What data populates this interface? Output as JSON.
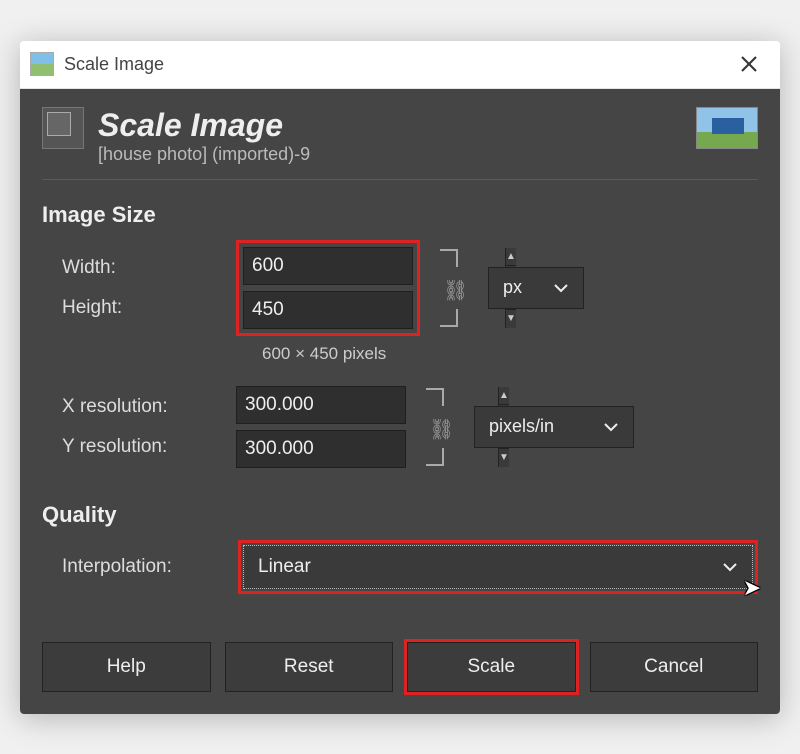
{
  "titlebar": {
    "title": "Scale Image"
  },
  "header": {
    "title": "Scale Image",
    "subtitle": "[house photo] (imported)-9"
  },
  "image_size": {
    "section_title": "Image Size",
    "width_label": "Width:",
    "height_label": "Height:",
    "width_value": "600",
    "height_value": "450",
    "unit_label": "px",
    "pixel_note": "600 × 450 pixels"
  },
  "resolution": {
    "x_label": "X resolution:",
    "y_label": "Y resolution:",
    "x_value": "300.000",
    "y_value": "300.000",
    "unit_label": "pixels/in"
  },
  "quality": {
    "section_title": "Quality",
    "interpolation_label": "Interpolation:",
    "interpolation_value": "Linear"
  },
  "buttons": {
    "help": "Help",
    "reset": "Reset",
    "scale": "Scale",
    "cancel": "Cancel"
  }
}
